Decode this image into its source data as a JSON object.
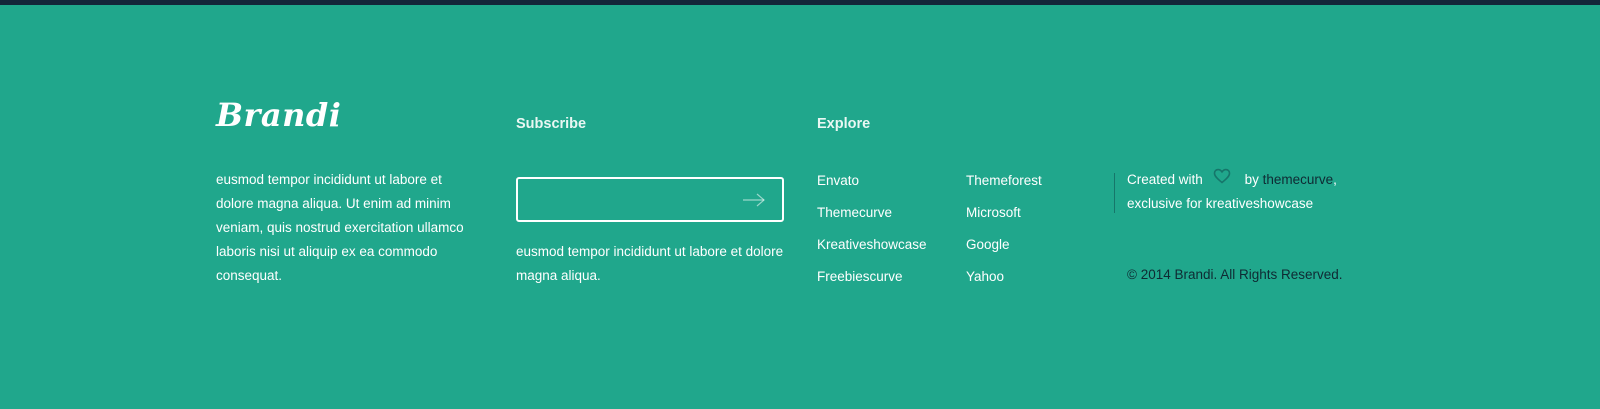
{
  "brand": {
    "logo_text": "Brandi"
  },
  "about": {
    "text": "eusmod tempor incididunt ut labore et dolore magna aliqua. Ut enim ad minim veniam, quis nostrud exercitation ullamco laboris nisi ut aliquip ex ea commodo consequat."
  },
  "subscribe": {
    "heading": "Subscribe",
    "input_value": "",
    "submit_icon": "arrow-right-icon",
    "note": "eusmod tempor incididunt ut labore et dolore magna aliqua."
  },
  "explore": {
    "heading": "Explore",
    "column_one": [
      "Envato",
      "Themecurve",
      "Kreativeshowcase",
      "Freebiescurve"
    ],
    "column_two": [
      "Themeforest",
      "Microsoft",
      "Google",
      "Yahoo"
    ]
  },
  "credits": {
    "created_with": "Created with",
    "heart_icon": "heart-icon",
    "by": "by",
    "author_link": "themecurve",
    "comma": ",",
    "exclusive": "exclusive for kreativeshowcase",
    "copyright": "© 2014 Brandi. All Rights Reserved."
  },
  "colors": {
    "background": "#20a78c",
    "top_bar": "#14263a",
    "dark_text": "#0f2a33"
  }
}
